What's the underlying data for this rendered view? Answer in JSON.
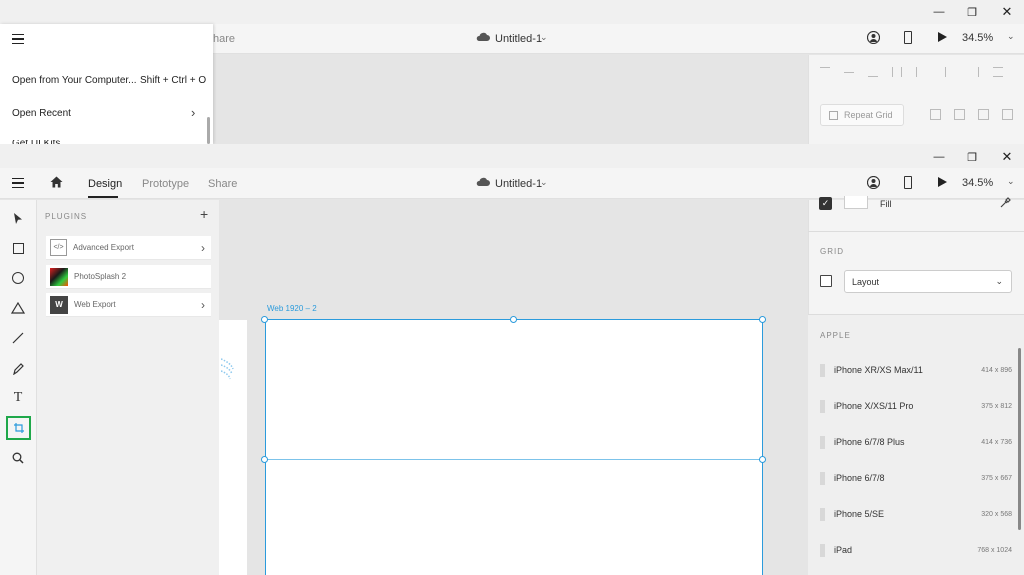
{
  "top_window": {
    "doc_title": "Untitled-1",
    "zoom": "34.5%",
    "share_tab_partial": "hare",
    "repeat_grid_label": "Repeat Grid",
    "menu": {
      "open_from_computer": "Open from Your Computer...",
      "open_shortcut": "Shift + Ctrl + O",
      "open_recent": "Open Recent",
      "get_ui_kits_partial": "Get UI Kits"
    }
  },
  "main_window": {
    "tabs": {
      "design": "Design",
      "prototype": "Prototype",
      "share": "Share"
    },
    "doc_title": "Untitled-1",
    "zoom": "34.5%",
    "plugins": {
      "header": "PLUGINS",
      "add": "+",
      "items": [
        {
          "name": "Advanced Export",
          "has_chevron": true
        },
        {
          "name": "PhotoSplash 2",
          "has_chevron": false
        },
        {
          "name": "Web Export",
          "has_chevron": true
        }
      ]
    },
    "artboard_label": "Web 1920 – 2",
    "right_panel": {
      "fill_label": "Fill",
      "grid_header": "GRID",
      "grid_layout_value": "Layout",
      "apple_header": "APPLE",
      "devices": [
        {
          "name": "iPhone XR/XS Max/11",
          "size": "414 x 896"
        },
        {
          "name": "iPhone X/XS/11 Pro",
          "size": "375 x 812"
        },
        {
          "name": "iPhone 6/7/8 Plus",
          "size": "414 x 736"
        },
        {
          "name": "iPhone 6/7/8",
          "size": "375 x 667"
        },
        {
          "name": "iPhone 5/SE",
          "size": "320 x 568"
        },
        {
          "name": "iPad",
          "size": "768 x 1024"
        }
      ]
    }
  },
  "colors": {
    "accent": "#2b9bdc",
    "highlight_box": "#1fa84a",
    "canvas": "#e5e5e5"
  }
}
